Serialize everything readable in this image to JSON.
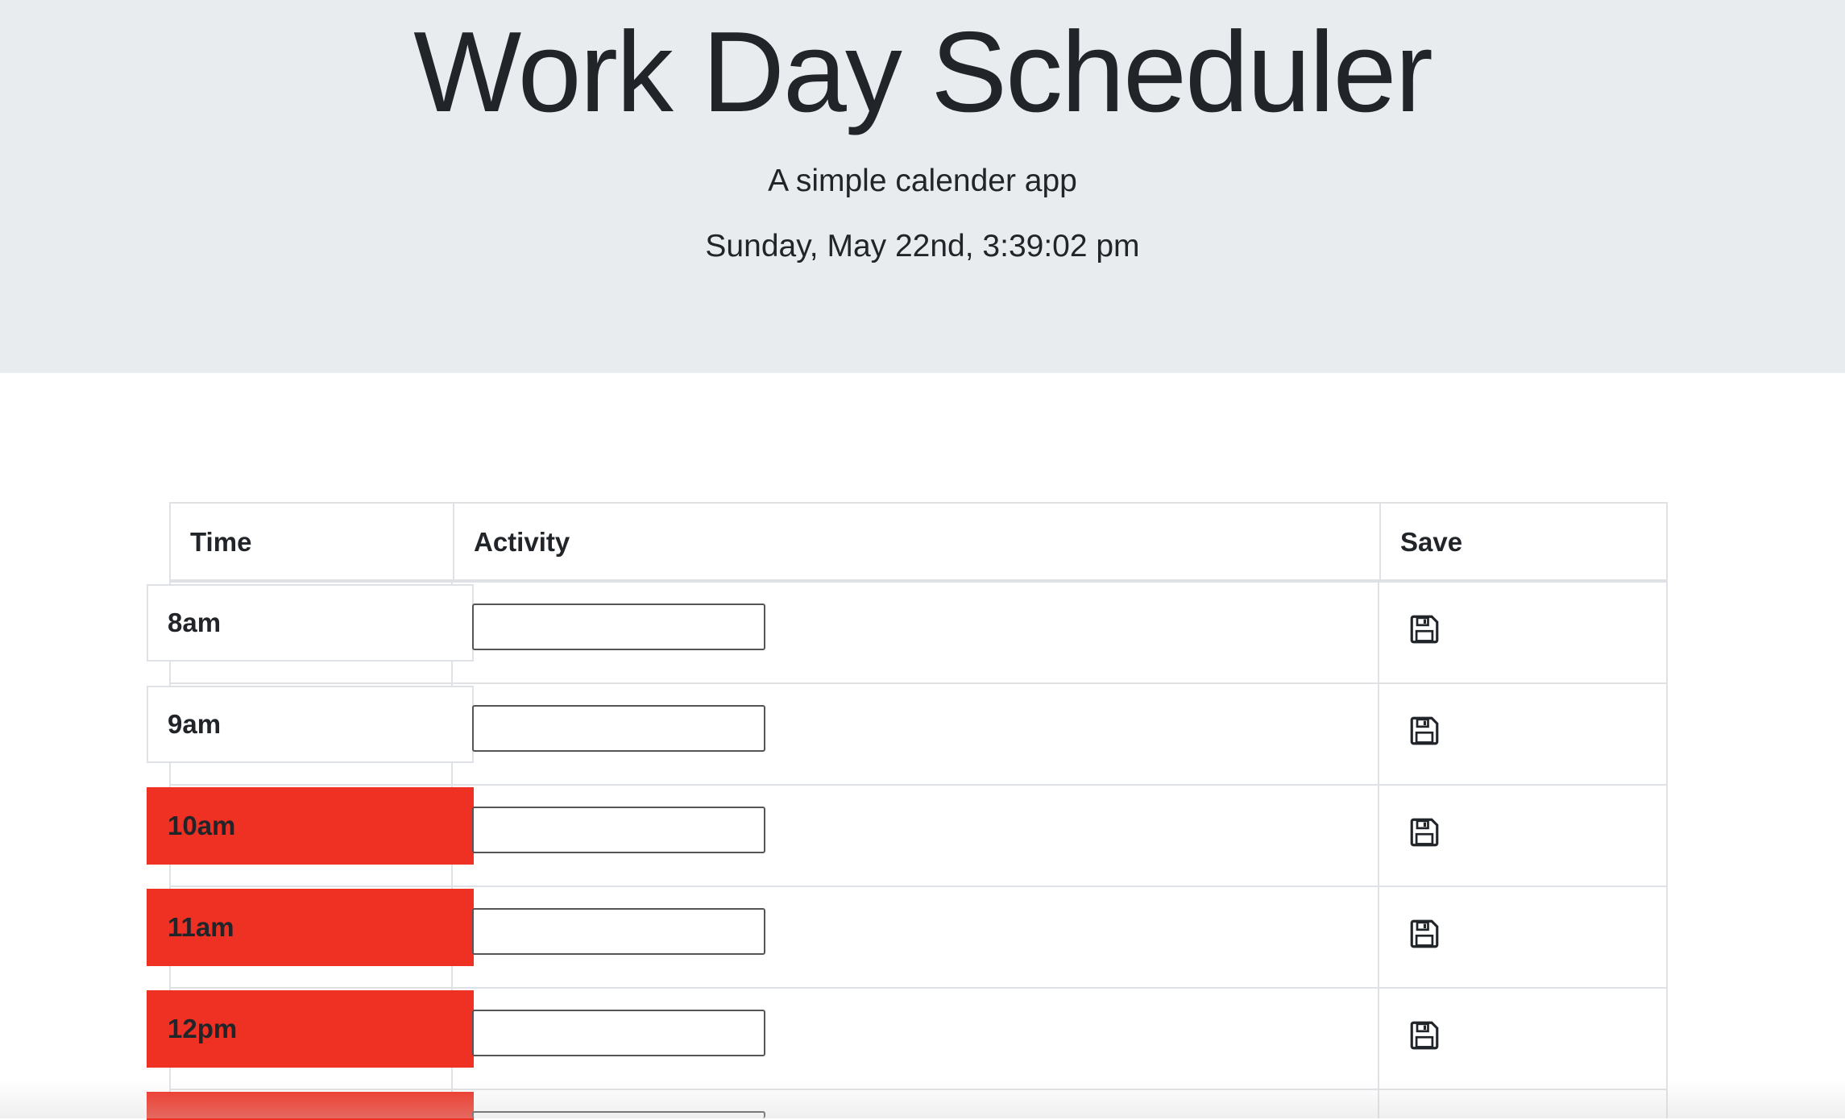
{
  "header": {
    "title": "Work Day Scheduler",
    "subtitle": "A simple calender app",
    "current_date": "Sunday, May 22nd, 3:39:02 pm"
  },
  "table": {
    "headers": {
      "time": "Time",
      "activity": "Activity",
      "save": "Save"
    },
    "rows": [
      {
        "time": "8am",
        "status": "past",
        "activity": ""
      },
      {
        "time": "9am",
        "status": "past",
        "activity": ""
      },
      {
        "time": "10am",
        "status": "present",
        "activity": ""
      },
      {
        "time": "11am",
        "status": "present",
        "activity": ""
      },
      {
        "time": "12pm",
        "status": "present",
        "activity": ""
      }
    ]
  },
  "colors": {
    "jumbotron_bg": "#e9ecef",
    "present": "#ef3124",
    "border": "#dee2e6"
  },
  "icons": {
    "save": "floppy-disk-icon"
  }
}
